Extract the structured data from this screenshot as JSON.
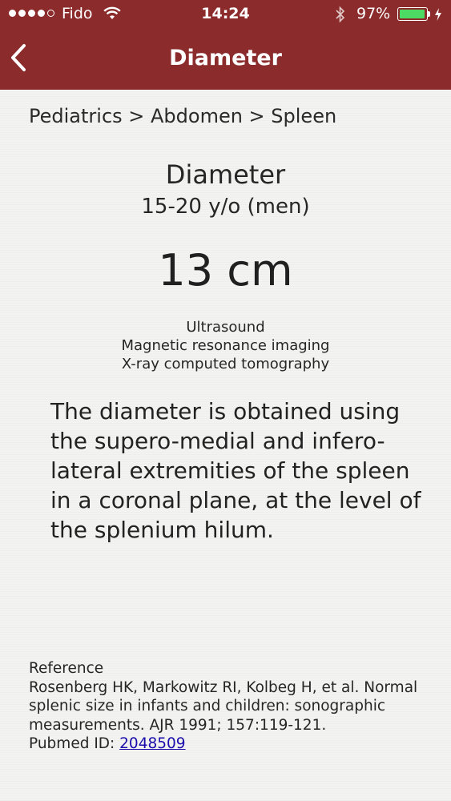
{
  "status_bar": {
    "carrier": "Fido",
    "time": "14:24",
    "battery_percent": "97%",
    "battery_level": 0.97,
    "battery_color": "#4cd964"
  },
  "nav": {
    "title": "Diameter",
    "back_icon": "chevron-left-icon",
    "bar_color": "#8b2b2b"
  },
  "breadcrumb": "Pediatrics > Abdomen > Spleen",
  "measurement": {
    "title": "Diameter",
    "subtitle": "15-20 y/o (men)",
    "value": "13 cm"
  },
  "modalities": [
    "Ultrasound",
    "Magnetic resonance imaging",
    "X-ray computed tomography"
  ],
  "description": "The diameter is obtained using the supero-medial and infero-lateral extremities of the spleen in a coronal plane, at the level of the splenium hilum.",
  "reference": {
    "heading": "Reference",
    "citation": "Rosenberg HK, Markowitz RI, Kolbeg H, et al. Normal splenic size in infants and children: sonographic measurements. AJR 1991; 157:119-121.",
    "pubmed_label": "Pubmed ID:",
    "pubmed_id": "2048509"
  }
}
